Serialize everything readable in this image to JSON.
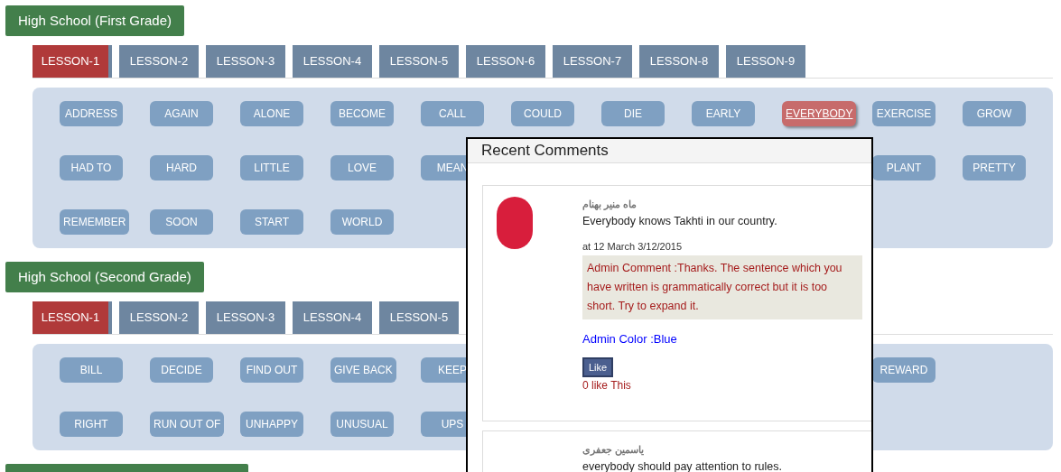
{
  "sections": [
    {
      "title": "High School (First Grade)",
      "tabs": [
        {
          "label": "LESSON-1",
          "selected": true
        },
        {
          "label": "LESSON-2",
          "selected": false
        },
        {
          "label": "LESSON-3",
          "selected": false
        },
        {
          "label": "LESSON-4",
          "selected": false
        },
        {
          "label": "LESSON-5",
          "selected": false
        },
        {
          "label": "LESSON-6",
          "selected": false
        },
        {
          "label": "LESSON-7",
          "selected": false
        },
        {
          "label": "LESSON-8",
          "selected": false
        },
        {
          "label": "LESSON-9",
          "selected": false
        }
      ],
      "word_rows": [
        {
          "words": [
            {
              "label": "ADDRESS",
              "selected": false
            },
            {
              "label": "AGAIN",
              "selected": false
            },
            {
              "label": "ALONE",
              "selected": false
            },
            {
              "label": "BECOME",
              "selected": false
            },
            {
              "label": "CALL",
              "selected": false
            },
            {
              "label": "COULD",
              "selected": false
            },
            {
              "label": "DIE",
              "selected": false
            },
            {
              "label": "EARLY",
              "selected": false
            },
            {
              "label": "EVERYBODY",
              "selected": true
            },
            {
              "label": "EXERCISE",
              "selected": false
            },
            {
              "label": "GROW",
              "selected": false
            }
          ],
          "trailing": []
        },
        {
          "words": [
            {
              "label": "HAD TO",
              "selected": false
            },
            {
              "label": "HARD",
              "selected": false
            },
            {
              "label": "LITTLE",
              "selected": false
            },
            {
              "label": "LOVE",
              "selected": false
            },
            {
              "label": "MEAN",
              "selected": false
            }
          ],
          "trailing": [
            {
              "label": "PLANT",
              "selected": false
            },
            {
              "label": "PRETTY",
              "selected": false
            }
          ]
        },
        {
          "words": [
            {
              "label": "REMEMBER",
              "selected": false
            },
            {
              "label": "SOON",
              "selected": false
            },
            {
              "label": "START",
              "selected": false
            },
            {
              "label": "WORLD",
              "selected": false
            }
          ],
          "trailing": []
        }
      ]
    },
    {
      "title": "High School (Second Grade)",
      "tabs": [
        {
          "label": "LESSON-1",
          "selected": true
        },
        {
          "label": "LESSON-2",
          "selected": false
        },
        {
          "label": "LESSON-3",
          "selected": false
        },
        {
          "label": "LESSON-4",
          "selected": false
        },
        {
          "label": "LESSON-5",
          "selected": false
        }
      ],
      "word_rows": [
        {
          "words": [
            {
              "label": "BILL",
              "selected": false
            },
            {
              "label": "DECIDE",
              "selected": false
            },
            {
              "label": "FIND OUT",
              "selected": false
            },
            {
              "label": "GIVE BACK",
              "selected": false
            },
            {
              "label": "KEEP",
              "selected": false
            }
          ],
          "trailing": [
            {
              "label": "REWARD",
              "selected": false
            }
          ]
        },
        {
          "words": [
            {
              "label": "RIGHT",
              "selected": false
            },
            {
              "label": "RUN OUT OF",
              "selected": false
            },
            {
              "label": "UNHAPPY",
              "selected": false
            },
            {
              "label": "UNUSUAL",
              "selected": false
            },
            {
              "label": "UPS",
              "selected": false
            }
          ],
          "trailing": []
        }
      ]
    }
  ],
  "recent_comments": {
    "title": "Recent Comments",
    "comments": [
      {
        "author": "ماه منیر بهنام",
        "text": "Everybody knows Takhti in our country.",
        "date": "at 12 March 3/12/2015",
        "admin_comment": "Admin Comment :Thanks. The sentence which you have written is grammatically correct but it is too short. Try to expand it.",
        "admin_color": "Admin Color :Blue",
        "like_button": "Like",
        "likes": "0 like This"
      },
      {
        "author": "یاسمین جعفری",
        "text": "everybody should pay attention to rules."
      }
    ]
  }
}
